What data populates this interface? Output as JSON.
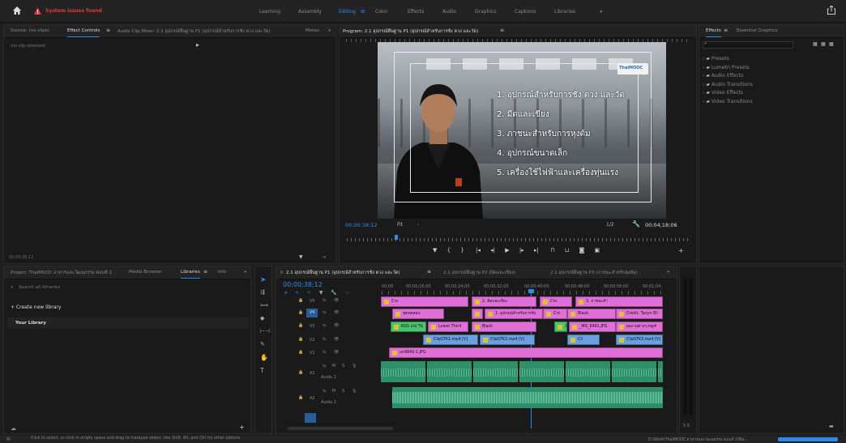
{
  "topbar": {
    "warning": "System issues found",
    "workspaces": [
      "Learning",
      "Assembly",
      "Editing",
      "Color",
      "Effects",
      "Audio",
      "Graphics",
      "Captions",
      "Libraries"
    ],
    "active_workspace": "Editing",
    "more": "»"
  },
  "source_panel": {
    "tabs": [
      "Source: (no clips)",
      "Effect Controls",
      "Audio Clip Mixer: 2.1 อุปกรณ์พื้นฐาน P1 (อุปกรณ์สำหรับการชั่ง ตวง และวัด)",
      "Metao"
    ],
    "active_tab": "Effect Controls",
    "no_clip": "(no clip selected)",
    "timecode": "00;00;38;12"
  },
  "program": {
    "title": "Program: 2.1 อุปกรณ์พื้นฐาน P1 (อุปกรณ์สำหรับการชั่ง ตวง และวัด)",
    "overlay_lines": [
      "1. อุปกรณ์สำหรับการชั่ง ตวง และวัด",
      "2. มีดและเขียง",
      "3. ภาชนะสำหรับการหุงต้ม",
      "4. อุปกรณ์ขนาดเล็ก",
      "5. เครื่องใช้ไฟฟ้าและเครื่องทุ่นแรง"
    ],
    "logo": "ThaiMOOC",
    "timecode": "00;00;38;12",
    "fit": "Fit",
    "resolution": "1/2",
    "duration": "00;04;18;06"
  },
  "effects": {
    "tabs": [
      "Effects",
      "Essential Graphics"
    ],
    "active_tab": "Effects",
    "search_placeholder": "",
    "items": [
      "Presets",
      "Lumetri Presets",
      "Audio Effects",
      "Audio Transitions",
      "Video Effects",
      "Video Transitions"
    ]
  },
  "project": {
    "tabs": [
      "Project: ThaiMOOC อาหารและวัฒนธรรม ตอนที่ 2",
      "Media Browser",
      "Libraries",
      "Info"
    ],
    "active_tab": "Libraries",
    "search_placeholder": "Search all libraries",
    "create": "+ Create new library",
    "library": "Your Library"
  },
  "timeline": {
    "tabs": [
      "2.1 อุปกรณ์พื้นฐาน P1 (อุปกรณ์สำหรับการชั่ง ตวง และวัด)",
      "2.1 อุปกรณ์พื้นฐาน P2 (มีดและเขียง)",
      "2.1 อุปกรณ์พื้นฐาน P3 (ภาชนะสำหรับหุงต้ม)"
    ],
    "timecode": "00;00;38;12",
    "ruler": [
      "00;00",
      "00;00;16;00",
      "00;00;24;00",
      "00;00;32;00",
      "00;00;40;00",
      "00;00;48;00",
      "00;00;56;00",
      "00;01;04;"
    ],
    "tracks": [
      "V5",
      "V4",
      "V3",
      "V2",
      "V1",
      "A1",
      "A2"
    ],
    "audio_labels": [
      "Audio 1",
      "Audio 2"
    ],
    "clips": {
      "v5": [
        "Cro",
        "2. มีดและเขียง",
        "Cro",
        "3. ภาชนะสำ"
      ],
      "v4": [
        "ชุดทดสอบ",
        "Cro",
        "1. อุปกรณ์สำหรับการชั่ง",
        "Cro",
        "Black",
        "Credit: Tanyn Eli"
      ],
      "v3": [
        "RGS Ltd Tic",
        "Lower Third",
        "Black",
        "1/1",
        "_MG_8481.JPG",
        "ผลงานต่างๆ.mp4"
      ],
      "v2": [
        "ClipSTK1.mp4 [V]",
        "ClipSTK2.mp4 [V]",
        "Cli",
        "ClipSTK3.mp4 [V]"
      ],
      "v1": [
        "un9840-1.JPG"
      ]
    }
  },
  "statusbar": {
    "hint": "Click to select, or click in empty space and drag to marquee select. Use Shift, Alt, and Ctrl for other options.",
    "path": "D:\\Work\\ThaiMOOC อาหารและวัฒนธรรม ตอนที่ 2\\Ba..."
  },
  "colors": {
    "accent": "#2d8ceb",
    "warning": "#e03a3a",
    "pink": "#e070d8",
    "green": "#49c46f",
    "blue": "#6aa0e0",
    "audio": "#2e8f6b"
  }
}
